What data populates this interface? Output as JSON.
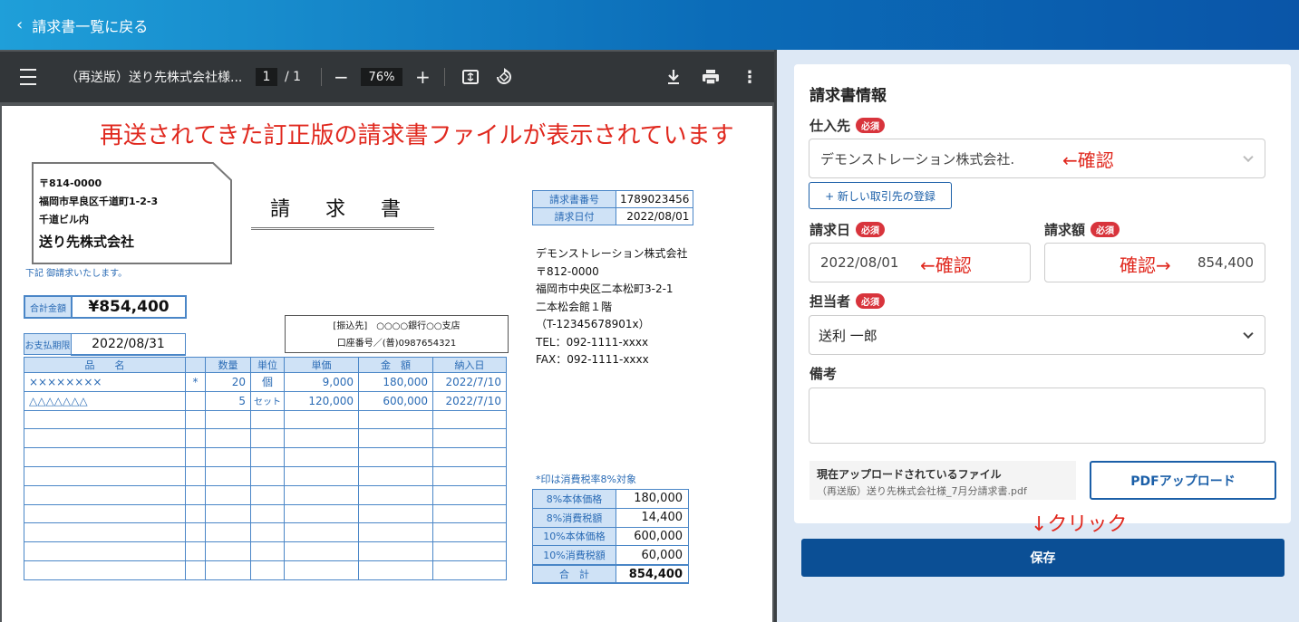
{
  "header": {
    "back_label": "請求書一覧に戻る"
  },
  "viewer": {
    "file_title": "（再送版）送り先株式会社様...",
    "page_current": "1",
    "page_total": "/ 1",
    "zoom": "76%"
  },
  "document": {
    "note": "再送されてきた訂正版の請求書ファイルが表示されています",
    "recipient": {
      "postal": "〒814-0000",
      "address1": "福岡市早良区千道町1-2-3",
      "address2": "千道ビル内",
      "name": "送り先株式会社"
    },
    "greeting": "下記 御請求いたします。",
    "title": "請 求 書",
    "meta": [
      {
        "label": "請求書番号",
        "value": "1789023456"
      },
      {
        "label": "請求日付",
        "value": "2022/08/01"
      }
    ],
    "sender": [
      "デモンストレーション株式会社",
      "〒812-0000",
      "福岡市中央区二本松町3-2-1",
      "二本松会館１階",
      "（T-12345678901x）",
      "TEL：092-1111-xxxx",
      "FAX：092-1111-xxxx"
    ],
    "total_label": "合計金額",
    "total_value": "¥854,400",
    "due_label": "お支払期限",
    "due_value": "2022/08/31",
    "bank_line1": "[振込先]　○○○○銀行○○支店",
    "bank_line2": "口座番号／(普)0987654321",
    "item_headers": [
      "品　　名",
      "",
      "数量",
      "単位",
      "単価",
      "金　額",
      "納入日"
    ],
    "items": [
      [
        "××××××××",
        "*",
        "20",
        "個",
        "9,000",
        "180,000",
        "2022/7/10"
      ],
      [
        "△△△△△△△",
        "",
        "5",
        "セット",
        "120,000",
        "600,000",
        "2022/7/10"
      ]
    ],
    "tax_note": "*印は消費税率8%対象",
    "tax": [
      {
        "label": "8%本体価格",
        "value": "180,000"
      },
      {
        "label": "8%消費税額",
        "value": "14,400"
      },
      {
        "label": "10%本体価格",
        "value": "600,000"
      },
      {
        "label": "10%消費税額",
        "value": "60,000"
      },
      {
        "label": "合　計",
        "value": "854,400"
      }
    ]
  },
  "form": {
    "title": "請求書情報",
    "required": "必須",
    "supplier_label": "仕入先",
    "supplier_value": "デモンストレーション株式会社.",
    "supplier_anno": "←確認",
    "new_partner": "+ 新しい取引先の登録",
    "date_label": "請求日",
    "date_value": "2022/08/01",
    "date_anno": "←確認",
    "amount_label": "請求額",
    "amount_value": "854,400",
    "amount_anno": "確認→",
    "person_label": "担当者",
    "person_value": "送利 一郎",
    "memo_label": "備考",
    "memo_value": "",
    "file_title": "現在アップロードされているファイル",
    "file_name": "（再送版）送り先株式会社様_7月分請求書.pdf",
    "upload_label": "PDFアップロード",
    "click_anno": "↓クリック",
    "save_label": "保存"
  }
}
